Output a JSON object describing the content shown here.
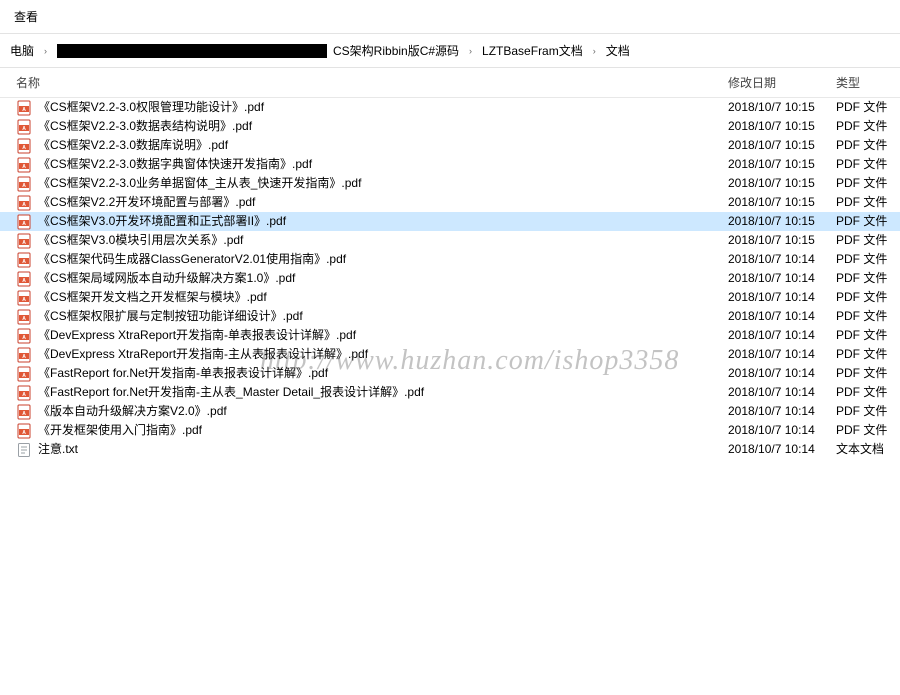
{
  "menu": {
    "view": "查看"
  },
  "breadcrumb": {
    "root": "电脑",
    "segments": [
      "CS架构Ribbin版C#源码",
      "LZTBaseFram文档",
      "文档"
    ]
  },
  "columns": {
    "name": "名称",
    "date": "修改日期",
    "type": "类型"
  },
  "types": {
    "pdf": "PDF 文件",
    "txt": "文本文档"
  },
  "files": [
    {
      "name": "《CS框架V2.2-3.0权限管理功能设计》.pdf",
      "date": "2018/10/7 10:15",
      "type": "pdf"
    },
    {
      "name": "《CS框架V2.2-3.0数据表结构说明》.pdf",
      "date": "2018/10/7 10:15",
      "type": "pdf"
    },
    {
      "name": "《CS框架V2.2-3.0数据库说明》.pdf",
      "date": "2018/10/7 10:15",
      "type": "pdf"
    },
    {
      "name": "《CS框架V2.2-3.0数据字典窗体快速开发指南》.pdf",
      "date": "2018/10/7 10:15",
      "type": "pdf"
    },
    {
      "name": "《CS框架V2.2-3.0业务单据窗体_主从表_快速开发指南》.pdf",
      "date": "2018/10/7 10:15",
      "type": "pdf"
    },
    {
      "name": "《CS框架V2.2开发环境配置与部署》.pdf",
      "date": "2018/10/7 10:15",
      "type": "pdf"
    },
    {
      "name": "《CS框架V3.0开发环境配置和正式部署II》.pdf",
      "date": "2018/10/7 10:15",
      "type": "pdf",
      "selected": true
    },
    {
      "name": "《CS框架V3.0模块引用层次关系》.pdf",
      "date": "2018/10/7 10:15",
      "type": "pdf"
    },
    {
      "name": "《CS框架代码生成器ClassGeneratorV2.01使用指南》.pdf",
      "date": "2018/10/7 10:14",
      "type": "pdf"
    },
    {
      "name": "《CS框架局域网版本自动升级解决方案1.0》.pdf",
      "date": "2018/10/7 10:14",
      "type": "pdf"
    },
    {
      "name": "《CS框架开发文档之开发框架与模块》.pdf",
      "date": "2018/10/7 10:14",
      "type": "pdf"
    },
    {
      "name": "《CS框架权限扩展与定制按钮功能详细设计》.pdf",
      "date": "2018/10/7 10:14",
      "type": "pdf"
    },
    {
      "name": "《DevExpress XtraReport开发指南-单表报表设计详解》.pdf",
      "date": "2018/10/7 10:14",
      "type": "pdf"
    },
    {
      "name": "《DevExpress XtraReport开发指南-主从表报表设计详解》.pdf",
      "date": "2018/10/7 10:14",
      "type": "pdf"
    },
    {
      "name": "《FastReport for.Net开发指南-单表报表设计详解》.pdf",
      "date": "2018/10/7 10:14",
      "type": "pdf"
    },
    {
      "name": "《FastReport for.Net开发指南-主从表_Master Detail_报表设计详解》.pdf",
      "date": "2018/10/7 10:14",
      "type": "pdf"
    },
    {
      "name": "《版本自动升级解决方案V2.0》.pdf",
      "date": "2018/10/7 10:14",
      "type": "pdf"
    },
    {
      "name": "《开发框架使用入门指南》.pdf",
      "date": "2018/10/7 10:14",
      "type": "pdf"
    },
    {
      "name": "注意.txt",
      "date": "2018/10/7 10:14",
      "type": "txt"
    }
  ],
  "watermark": "http://www.huzhan.com/ishop3358"
}
